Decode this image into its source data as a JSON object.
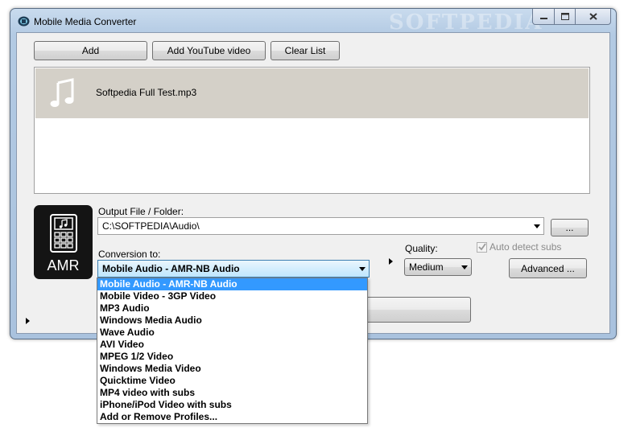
{
  "window": {
    "title": "Mobile Media Converter",
    "title_watermark": "SOFTPEDIA"
  },
  "toolbar": {
    "add_label": "Add",
    "add_youtube_label": "Add YouTube video",
    "clear_list_label": "Clear List"
  },
  "file_list": {
    "items": [
      {
        "name": "Softpedia Full Test.mp3",
        "icon": "music-note-icon"
      }
    ]
  },
  "profile_icon": {
    "label": "AMR",
    "icon": "phone-keypad-music-icon"
  },
  "output": {
    "label": "Output File / Folder:",
    "value": "C:\\SOFTPEDIA\\Audio\\",
    "browse_label": "..."
  },
  "conversion": {
    "label": "Conversion to:",
    "selected": "Mobile Audio - AMR-NB Audio",
    "options": [
      "Mobile Audio - AMR-NB Audio",
      "Mobile Video - 3GP Video",
      "MP3 Audio",
      "Windows Media Audio",
      "Wave Audio",
      "AVI Video",
      "MPEG 1/2 Video",
      "Windows Media Video",
      "Quicktime Video",
      "MP4 video with subs",
      "iPhone/iPod Video with subs",
      "Add or Remove Profiles..."
    ]
  },
  "quality": {
    "label": "Quality:",
    "selected": "Medium"
  },
  "auto_detect_subs": {
    "label": "Auto detect subs",
    "checked": true
  },
  "advanced_label": "Advanced ...",
  "colors": {
    "selection": "#3399ff",
    "list_row_bg": "#d4d0c8",
    "client_bg": "#f0f0f0"
  }
}
